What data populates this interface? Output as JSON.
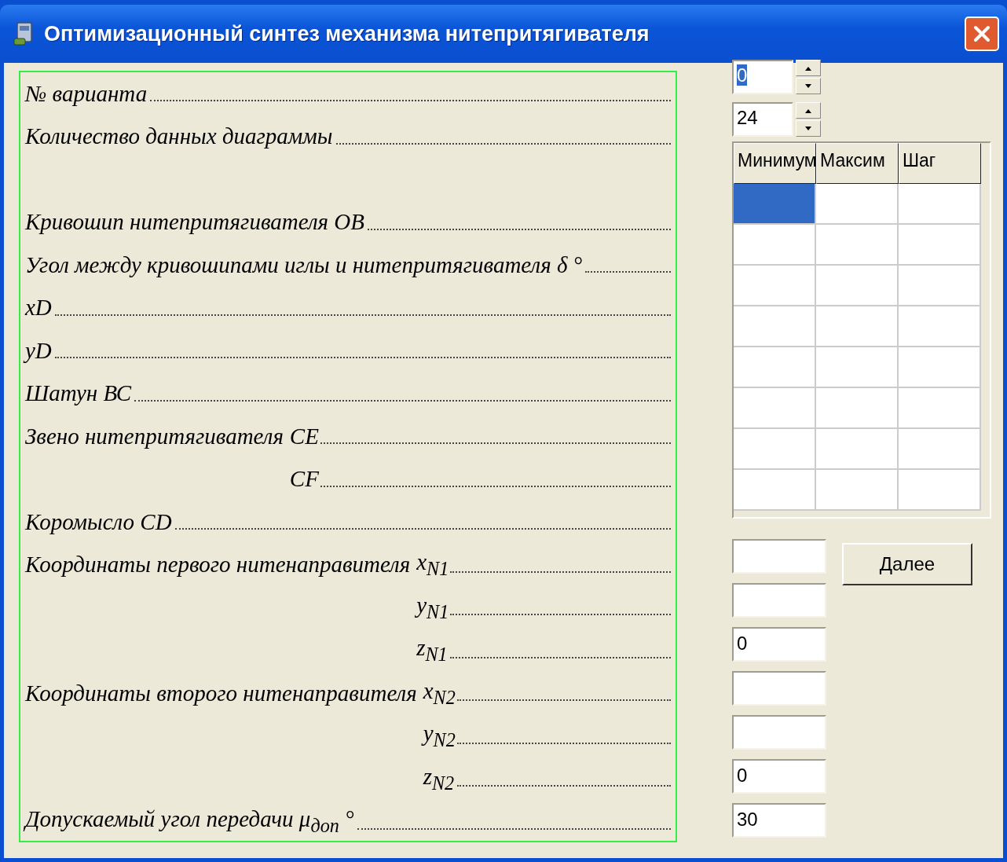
{
  "window": {
    "title": "Оптимизационный синтез механизма нитепритягивателя"
  },
  "labels": [
    {
      "label": "№ варианта"
    },
    {
      "label": "Количество данных диаграммы"
    },
    {
      "label": "Кривошип нитепритягивателя ОВ"
    },
    {
      "label": "Угол между кривошипами иглы и нитепритягивателя δ °"
    },
    {
      "label": "xD"
    },
    {
      "label": "yD"
    },
    {
      "label": "Шатун ВС"
    },
    {
      "label": "Звено нитепритягивателя",
      "vars": [
        "CE",
        "CF"
      ]
    },
    {
      "label": "Коромысло CD"
    },
    {
      "label": "Координаты первого нитенаправителя",
      "vars": [
        "x$_{N1}$",
        "y$_{N1}$",
        "z$_{N1}$"
      ]
    },
    {
      "label": "Координаты второго нитенаправителя",
      "vars": [
        "x$_{N2}$",
        "y$_{N2}$",
        "z$_{N2}$"
      ]
    },
    {
      "label": "Допускаемый угол передачи μ$_{доп}$ °"
    }
  ],
  "spinners": [
    {
      "value": "0",
      "selected": true
    },
    {
      "value": "24",
      "selected": false
    }
  ],
  "table": {
    "columns": [
      "Минимум",
      "Максим",
      "Шаг"
    ],
    "rows": [
      {
        "cells": [
          {
            "selected": true
          },
          {
            "selected": false
          },
          {
            "selected": false
          }
        ]
      },
      {
        "cells": [
          {
            "selected": false
          },
          {
            "selected": false
          },
          {
            "selected": false
          }
        ]
      },
      {
        "cells": [
          {
            "selected": false
          },
          {
            "selected": false
          },
          {
            "selected": false
          }
        ]
      },
      {
        "cells": [
          {
            "selected": false
          },
          {
            "selected": false
          },
          {
            "selected": false
          }
        ]
      },
      {
        "cells": [
          {
            "selected": false
          },
          {
            "selected": false
          },
          {
            "selected": false
          }
        ]
      },
      {
        "cells": [
          {
            "selected": false
          },
          {
            "selected": false
          },
          {
            "selected": false
          }
        ]
      },
      {
        "cells": [
          {
            "selected": false
          },
          {
            "selected": false
          },
          {
            "selected": false
          }
        ]
      },
      {
        "cells": [
          {
            "selected": false
          },
          {
            "selected": false
          },
          {
            "selected": false
          }
        ]
      }
    ]
  },
  "fields": [
    {
      "kind": "empty"
    },
    {
      "kind": "empty"
    },
    {
      "kind": "filled",
      "value": "0"
    },
    {
      "kind": "empty"
    },
    {
      "kind": "empty"
    },
    {
      "kind": "filled",
      "value": "0"
    },
    {
      "kind": "filled",
      "value": "30"
    }
  ],
  "button": "Далее"
}
